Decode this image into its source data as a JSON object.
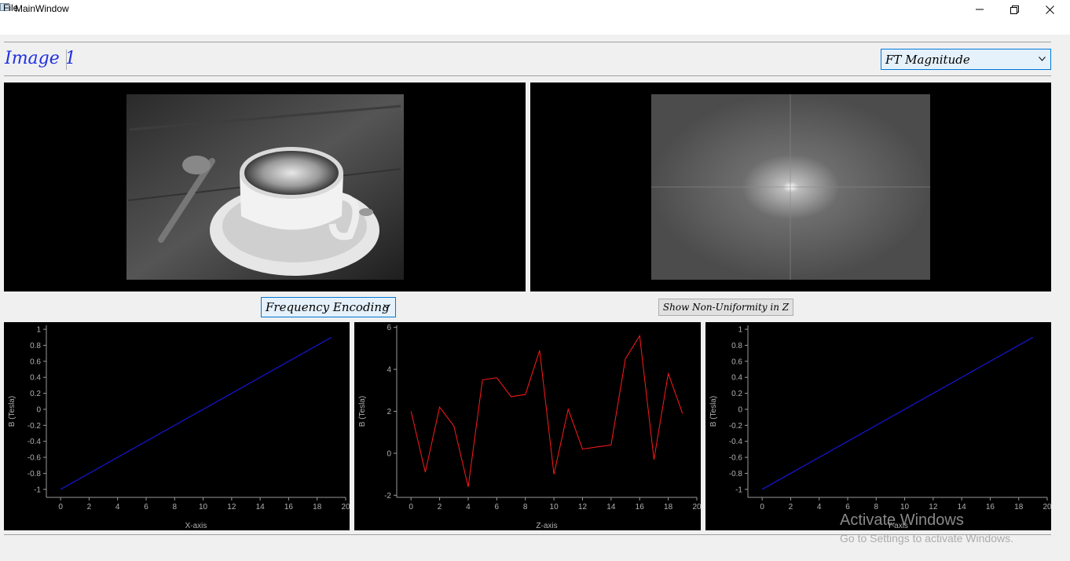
{
  "window": {
    "title": "MainWindow"
  },
  "menubar": {
    "file": "File"
  },
  "header": {
    "image_title": "Image 1",
    "view_select": "FT Magnitude"
  },
  "controls": {
    "encoding_select": "Frequency Encoding",
    "nonuniform_button": "Show Non-Uniformity in Z"
  },
  "watermark": {
    "title": "Activate Windows",
    "subtitle": "Go to Settings to activate Windows."
  },
  "colors": {
    "title_blue": "#1f30e0",
    "combo_bg": "#e5f1fb",
    "combo_border": "#0078d7",
    "line_blue": "#1a1aff",
    "line_red": "#ff1a1a"
  },
  "icons": [
    "app-icon",
    "minimize-icon",
    "restore-icon",
    "close-icon",
    "chevron-down-icon"
  ],
  "chart_data": [
    {
      "type": "line",
      "xlabel": "X-axis",
      "ylabel": "B (Tesla)",
      "xlim": [
        -1,
        20
      ],
      "ylim": [
        -1.1,
        1.05
      ],
      "xticks": [
        0,
        2,
        4,
        6,
        8,
        10,
        12,
        14,
        16,
        18,
        20
      ],
      "yticks": [
        -1,
        -0.8,
        -0.6,
        -0.4,
        -0.2,
        0,
        0.2,
        0.4,
        0.6,
        0.8,
        1
      ],
      "color": "#1a1aff",
      "series": [
        {
          "x": [
            0,
            19
          ],
          "y": [
            -1,
            0.9
          ]
        }
      ]
    },
    {
      "type": "line",
      "xlabel": "Z-axis",
      "ylabel": "B (Tesla)",
      "xlim": [
        -1,
        20
      ],
      "ylim": [
        -2.1,
        6.1
      ],
      "xticks": [
        0,
        2,
        4,
        6,
        8,
        10,
        12,
        14,
        16,
        18,
        20
      ],
      "yticks": [
        -2,
        0,
        2,
        4,
        6
      ],
      "color": "#ff1a1a",
      "series": [
        {
          "x": [
            0,
            1,
            2,
            3,
            4,
            5,
            6,
            7,
            8,
            9,
            10,
            11,
            12,
            13,
            14,
            15,
            16,
            17,
            18,
            19
          ],
          "y": [
            2.0,
            -0.9,
            2.2,
            1.3,
            -1.6,
            3.5,
            3.6,
            2.7,
            2.8,
            4.9,
            -1.0,
            2.1,
            0.2,
            0.3,
            0.4,
            4.5,
            5.6,
            -0.3,
            3.8,
            1.9
          ]
        }
      ]
    },
    {
      "type": "line",
      "xlabel": "Y-axis",
      "ylabel": "B (Tesla)",
      "xlim": [
        -1,
        20
      ],
      "ylim": [
        -1.1,
        1.05
      ],
      "xticks": [
        0,
        2,
        4,
        6,
        8,
        10,
        12,
        14,
        16,
        18,
        20
      ],
      "yticks": [
        -1,
        -0.8,
        -0.6,
        -0.4,
        -0.2,
        0,
        0.2,
        0.4,
        0.6,
        0.8,
        1
      ],
      "color": "#1a1aff",
      "series": [
        {
          "x": [
            0,
            19
          ],
          "y": [
            -1,
            0.9
          ]
        }
      ]
    }
  ]
}
